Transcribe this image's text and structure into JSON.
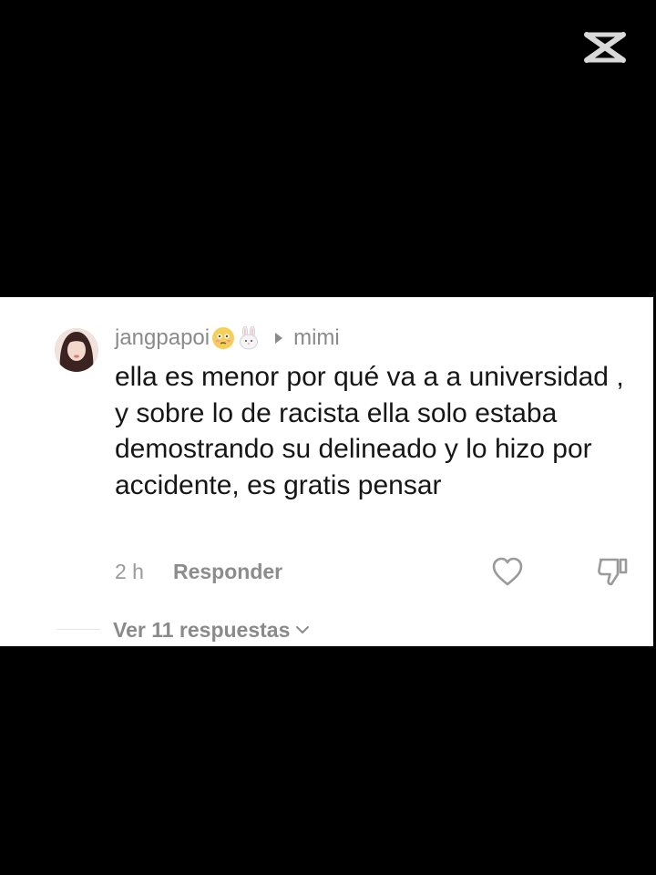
{
  "watermark": {
    "icon": "capcut-logo-icon"
  },
  "comment": {
    "username": "jangpapoi",
    "username_emojis": [
      "flushed-face-icon",
      "rabbit-face-icon"
    ],
    "reply_to": "mimi",
    "text": "ella es menor por qué va a a universidad , y sobre lo de racista ella solo estaba demostrando su delineado y lo hizo por accidente, es gratis pensar",
    "time": "2 h",
    "reply_label": "Responder",
    "like_icon": "heart-outline-icon",
    "dislike_icon": "thumbs-down-outline-icon",
    "view_replies": "Ver 11 respuestas"
  },
  "colors": {
    "background": "#000000",
    "card": "#ffffff",
    "text": "#161616",
    "muted": "#8a8a8a"
  }
}
